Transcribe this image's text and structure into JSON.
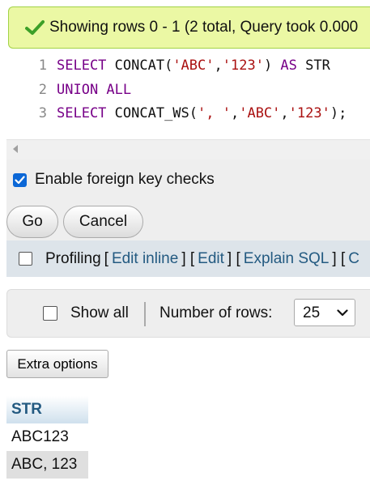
{
  "message": {
    "text": "Showing rows 0 - 1 (2 total, Query took 0.000",
    "color_bg": "#ebf8a4",
    "icon": "checkmark-icon"
  },
  "sql": {
    "lines": [
      {
        "num": "1",
        "t1": "SELECT",
        "t2": " CONCAT(",
        "t3": "'ABC'",
        "t4": ",",
        "t5": "'123'",
        "t6": ") ",
        "t7": "AS",
        "t8": " STR"
      },
      {
        "num": "2",
        "t1": "UNION ALL"
      },
      {
        "num": "3",
        "t1": "SELECT",
        "t2": " CONCAT_WS(",
        "t3": "', '",
        "t4": ",",
        "t5": "'ABC'",
        "t6": ",",
        "t7": "'123'",
        "t8": ");"
      }
    ]
  },
  "options": {
    "foreign_key_label": "Enable foreign key checks",
    "go_label": "Go",
    "cancel_label": "Cancel"
  },
  "profiling": {
    "label": "Profiling",
    "links": [
      "Edit inline",
      "Edit",
      "Explain SQL",
      "C"
    ]
  },
  "navigation": {
    "show_all_label": "Show all",
    "number_of_rows_label": "Number of rows:",
    "rows_value": "25"
  },
  "extra_options_label": "Extra options",
  "results": {
    "columns": [
      "STR"
    ],
    "rows": [
      [
        "ABC123"
      ],
      [
        "ABC, 123"
      ]
    ]
  }
}
